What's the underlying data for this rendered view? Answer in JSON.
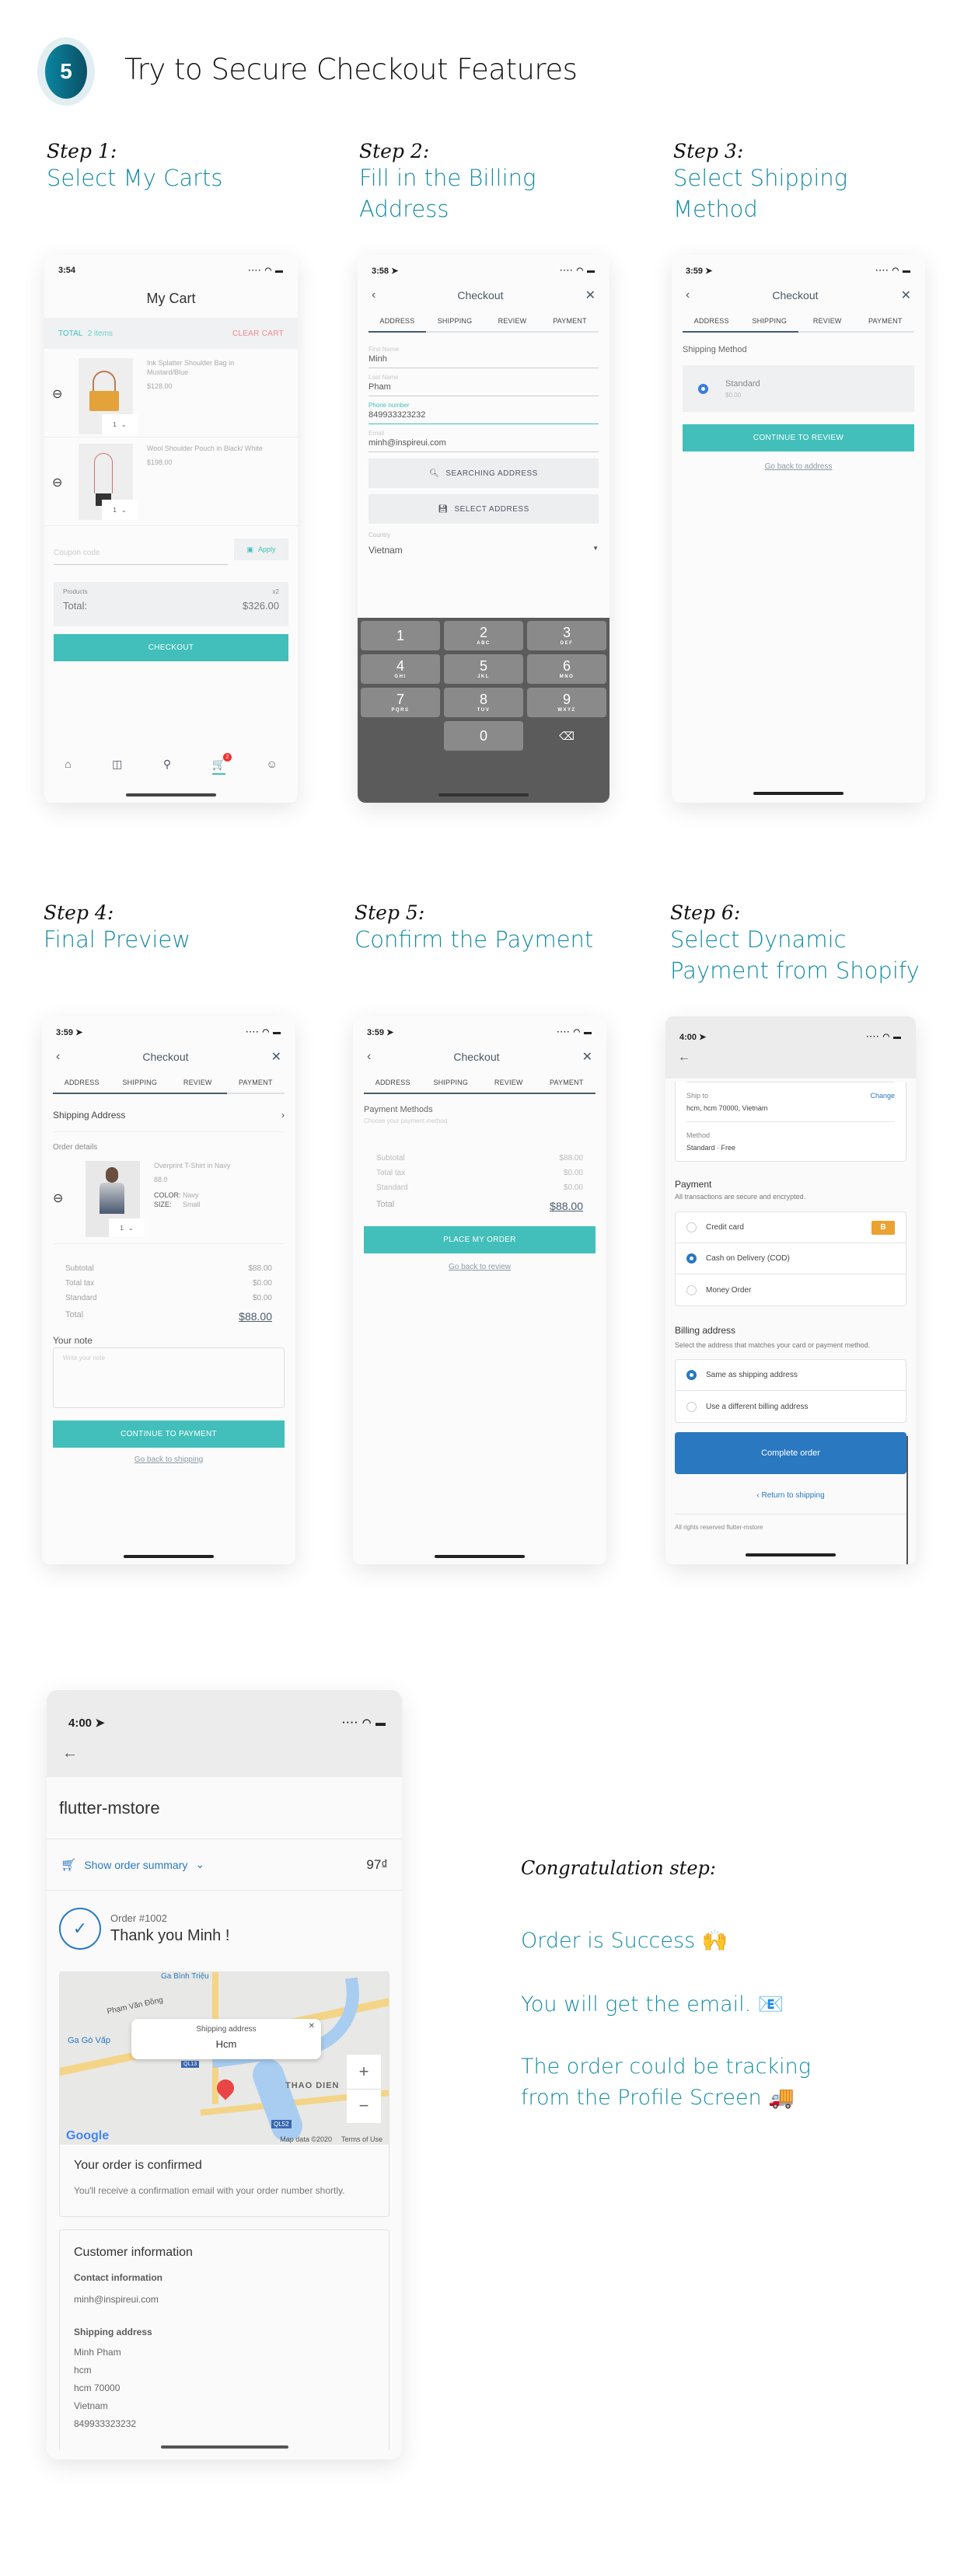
{
  "hero": {
    "badge_number": "5",
    "title": "Try to Secure Checkout Features"
  },
  "steps": [
    {
      "label": "Step 1:",
      "title_lines": [
        "Select My Carts"
      ]
    },
    {
      "label": "Step 2:",
      "title_lines": [
        "Fill in the Billing",
        "Address"
      ]
    },
    {
      "label": "Step 3:",
      "title_lines": [
        "Select Shipping",
        "Method"
      ]
    },
    {
      "label": "Step 4:",
      "title_lines": [
        "Final Preview"
      ]
    },
    {
      "label": "Step 5:",
      "title_lines": [
        "Confirm the Payment"
      ]
    },
    {
      "label": "Step 6:",
      "title_lines": [
        "Select Dynamic",
        "Payment from Shopify"
      ]
    }
  ],
  "checkout_tabs": [
    "ADDRESS",
    "SHIPPING",
    "REVIEW",
    "PAYMENT"
  ],
  "checkout_title": "Checkout",
  "cart": {
    "time": "3:54",
    "title": "My Cart",
    "total_label": "TOTAL",
    "items_count": "2 items",
    "clear_label": "CLEAR CART",
    "items": [
      {
        "name": "Ink Splatter Shoulder Bag in Mustard/Blue",
        "price": "$128.00",
        "qty": "1"
      },
      {
        "name": "Wool Shoulder Pouch in Black/ White",
        "price": "$198.00",
        "qty": "1"
      }
    ],
    "coupon_placeholder": "Coupon code",
    "apply_label": "Apply",
    "products_label": "Products",
    "products_count": "x2",
    "total_text": "Total:",
    "total_value": "$326.00",
    "checkout_label": "CHECKOUT",
    "cart_badge": "2"
  },
  "address": {
    "time": "3:58",
    "fields": [
      {
        "label": "First Name",
        "value": "Minh"
      },
      {
        "label": "Last Name",
        "value": "Pham"
      },
      {
        "label": "Phone number",
        "value": "849933323232"
      },
      {
        "label": "Email",
        "value": "minh@inspireui.com"
      }
    ],
    "search_label": "SEARCHING ADDRESS",
    "select_label": "SELECT ADDRESS",
    "country_label": "Country",
    "country_value": "Vietnam",
    "keys": [
      {
        "n": "1",
        "s": ""
      },
      {
        "n": "2",
        "s": "ABC"
      },
      {
        "n": "3",
        "s": "DEF"
      },
      {
        "n": "4",
        "s": "GHI"
      },
      {
        "n": "5",
        "s": "JKL"
      },
      {
        "n": "6",
        "s": "MNO"
      },
      {
        "n": "7",
        "s": "PQRS"
      },
      {
        "n": "8",
        "s": "TUV"
      },
      {
        "n": "9",
        "s": "WXYZ"
      },
      {
        "n": "0",
        "s": ""
      }
    ]
  },
  "shipping": {
    "time": "3:59",
    "section_label": "Shipping Method",
    "method_name": "Standard",
    "method_price": "$0.00",
    "continue_label": "CONTINUE TO REVIEW",
    "back_link": "Go back to address"
  },
  "review": {
    "time": "3:59",
    "shipping_address_label": "Shipping Address",
    "order_details_label": "Order details",
    "item": {
      "name": "Overprint T-Shirt in Navy",
      "price": "88.0",
      "color_label": "COLOR:",
      "color": "Navy",
      "size_label": "SIZE:",
      "size": "Small",
      "qty": "1"
    },
    "summary": [
      {
        "label": "Subtotal",
        "value": "$88.00"
      },
      {
        "label": "Total tax",
        "value": "$0.00"
      },
      {
        "label": "Standard",
        "value": "$0.00"
      }
    ],
    "total_label": "Total",
    "total_value": "$88.00",
    "note_label": "Your note",
    "note_placeholder": "Write your note",
    "continue_label": "CONTINUE TO PAYMENT",
    "back_link": "Go back to shipping"
  },
  "payment": {
    "time": "3:59",
    "methods_title": "Payment Methods",
    "methods_subtitle": "Choose your payment method",
    "summary": [
      {
        "label": "Subtotal",
        "value": "$88.00"
      },
      {
        "label": "Total tax",
        "value": "$0.00"
      },
      {
        "label": "Standard",
        "value": "$0.00"
      }
    ],
    "total_label": "Total",
    "total_value": "$88.00",
    "place_label": "PLACE MY ORDER",
    "back_link": "Go back to review"
  },
  "shopify": {
    "time": "4:00",
    "ship_to_label": "Ship to",
    "change_label": "Change",
    "ship_to_value": "hcm, hcm 70000, Vietnam",
    "method_label": "Method",
    "method_value": "Standard · Free",
    "payment_title": "Payment",
    "payment_subtitle": "All transactions are secure and encrypted.",
    "payment_options": [
      {
        "label": "Credit card",
        "selected": false,
        "badge": "B"
      },
      {
        "label": "Cash on Delivery (COD)",
        "selected": true
      },
      {
        "label": "Money Order",
        "selected": false
      }
    ],
    "billing_title": "Billing address",
    "billing_subtitle": "Select the address that matches your card or payment method.",
    "billing_options": [
      {
        "label": "Same as shipping address",
        "selected": true
      },
      {
        "label": "Use a different billing address",
        "selected": false
      }
    ],
    "complete_label": "Complete order",
    "return_link": "Return to shipping",
    "footer": "All rights reserved flutter-mstore"
  },
  "success": {
    "time": "4:00",
    "store_name": "flutter-mstore",
    "summary_toggle": "Show order summary",
    "summary_total": "97₫",
    "order_number": "Order #1002",
    "thank_you": "Thank you Minh !",
    "map": {
      "popup_title": "Shipping address",
      "popup_value": "Hcm",
      "labels": [
        "Phạm Văn Đồng",
        "Ga Gò Vấp",
        "THAO DIEN",
        "QL52",
        "QL13",
        "Ga Bình Triệu"
      ],
      "attribution": "Map data ©2020",
      "terms": "Terms of Use",
      "logo": "Google"
    },
    "confirmed_title": "Your order is confirmed",
    "confirmed_text": "You'll receive a confirmation email with your order number shortly.",
    "customer_title": "Customer information",
    "contact_label": "Contact information",
    "contact_email": "minh@inspireui.com",
    "shipping_label": "Shipping address",
    "shipping_lines": [
      "Minh Pham",
      "hcm",
      "hcm 70000",
      "Vietnam",
      "849933323232"
    ]
  },
  "congrats": {
    "label": "Congratulation step:",
    "lines": [
      "Order is Success 🙌",
      "You will get the email. 📧",
      "The order could be tracking",
      "from the Profile Screen 🚚"
    ]
  },
  "colors": {
    "teal": "#42bfba",
    "title_blue": "#128ba3",
    "shopify_blue": "#2a78c0",
    "clear_cart": "#f08a8a"
  }
}
